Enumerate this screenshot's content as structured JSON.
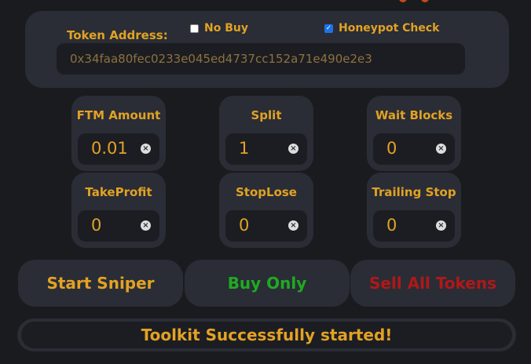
{
  "token": {
    "label": "Token Address:",
    "address": "0x34faa80fec0233e045ed4737cc152a71e490e2e3"
  },
  "options": {
    "no_buy": {
      "label": "No Buy",
      "checked": false
    },
    "honeypot_check": {
      "label": "Honeypot Check",
      "checked": true
    }
  },
  "fields": {
    "ftm_amount": {
      "label": "FTM Amount",
      "value": "0.01"
    },
    "split": {
      "label": "Split",
      "value": "1"
    },
    "wait_blocks": {
      "label": "Wait Blocks",
      "value": "0"
    },
    "take_profit": {
      "label": "TakeProfit",
      "value": "0"
    },
    "stop_lose": {
      "label": "StopLose",
      "value": "0"
    },
    "trailing_stop": {
      "label": "Trailing Stop",
      "value": "0"
    },
    "clear_glyph": "×"
  },
  "buttons": {
    "start_sniper": "Start Sniper",
    "buy_only": "Buy Only",
    "sell_all": "Sell All Tokens"
  },
  "status": {
    "message": "Toolkit Successfully started!"
  },
  "colors": {
    "accent": "#e2a224",
    "buy_green": "#1faa22",
    "sell_red": "#b01818",
    "panel": "#2a2d35",
    "background": "#1a1b1e"
  }
}
